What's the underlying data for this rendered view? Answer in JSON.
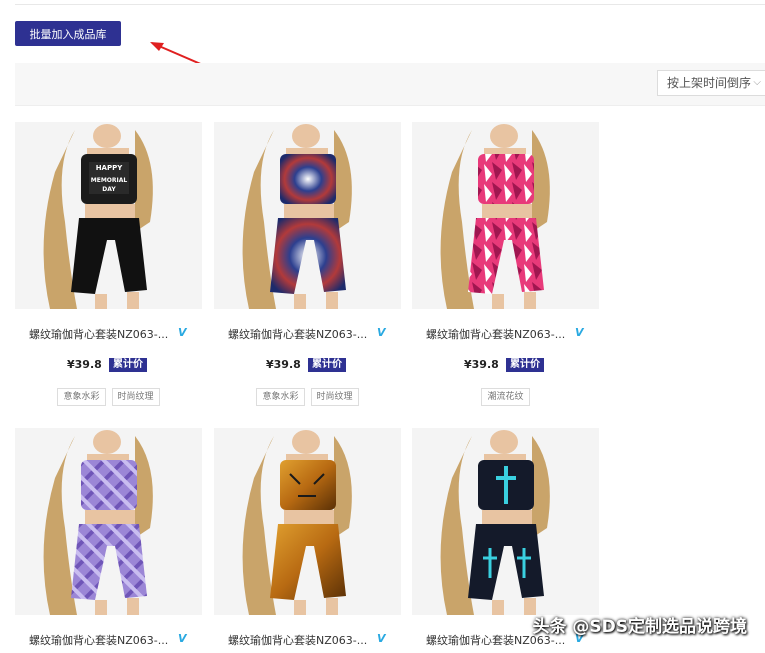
{
  "toolbar": {
    "bulk_add_label": "批量加入成品库"
  },
  "sort": {
    "selected": "按上架时间倒序"
  },
  "accent": "#2e3192",
  "products": [
    {
      "title": "螺纹瑜伽背心套装NZ063-...",
      "badge": "V",
      "price": "¥39.8",
      "price_label": "累计价",
      "tags": [
        "意象水彩",
        "时尚纹理"
      ],
      "design": "memorial-day-black"
    },
    {
      "title": "螺纹瑜伽背心套装NZ063-...",
      "badge": "V",
      "price": "¥39.8",
      "price_label": "累计价",
      "tags": [
        "意象水彩",
        "时尚纹理"
      ],
      "design": "tie-dye-red-blue"
    },
    {
      "title": "螺纹瑜伽背心套装NZ063-...",
      "badge": "V",
      "price": "¥39.8",
      "price_label": "累计价",
      "tags": [
        "潮流花纹"
      ],
      "design": "pink-camo"
    },
    {
      "title": "螺纹瑜伽背心套装NZ063-...",
      "badge": "V",
      "design": "purple-plaid"
    },
    {
      "title": "螺纹瑜伽背心套装NZ063-...",
      "badge": "V",
      "design": "tiger-print"
    },
    {
      "title": "螺纹瑜伽背心套装NZ063-...",
      "badge": "V",
      "design": "cross-black"
    }
  ],
  "watermark": "头条 @SDS定制选品说跨境"
}
